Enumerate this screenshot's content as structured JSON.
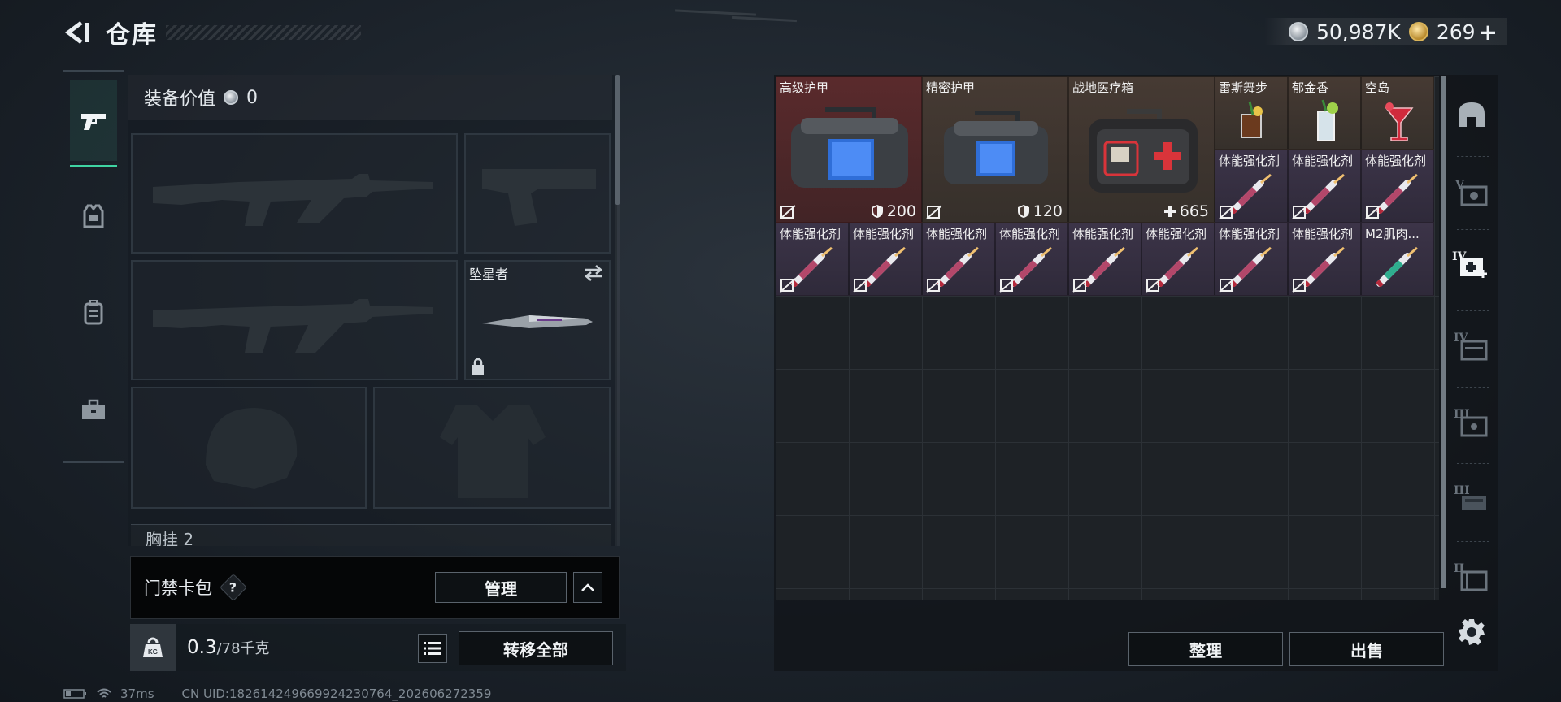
{
  "header": {
    "title": "仓库"
  },
  "currency": {
    "silver": "50,987K",
    "gold": "269",
    "plus": "+"
  },
  "side_tabs": [
    {
      "name": "tab-weapons",
      "icon": "pistol-icon",
      "active": true
    },
    {
      "name": "tab-armor",
      "icon": "armor-vest-icon",
      "active": false
    },
    {
      "name": "tab-backpack",
      "icon": "backpack-icon",
      "active": false
    },
    {
      "name": "tab-toolbox",
      "icon": "toolbox-icon",
      "active": false
    }
  ],
  "equipment": {
    "value_label": "装备价值",
    "value": "0",
    "melee_label": "坠星者",
    "chest_label": "胸挂 2"
  },
  "keycard": {
    "label": "门禁卡包",
    "help": "?",
    "manage": "管理"
  },
  "weight": {
    "current": "0.3",
    "max": "/78千克",
    "transfer_all": "转移全部"
  },
  "status": {
    "ping": "37ms",
    "uid": "CN UID:18261424966992423076​4_202606272359"
  },
  "inventory": {
    "items": [
      {
        "name": "高级护甲",
        "stat": "200",
        "stat_icon": "shield-icon"
      },
      {
        "name": "精密护甲",
        "stat": "120",
        "stat_icon": "shield-icon"
      },
      {
        "name": "战地医疗箱",
        "stat": "665",
        "stat_icon": "plus-icon"
      },
      {
        "name": "雷斯舞步"
      },
      {
        "name": "郁金香"
      },
      {
        "name": "空岛"
      },
      {
        "name": "体能强化剂"
      },
      {
        "name": "M2肌肉..."
      }
    ],
    "sort_label": "整理",
    "sell_label": "出售"
  },
  "right_nav": [
    {
      "name": "helmet-icon"
    },
    {
      "name": "vault-v-icon"
    },
    {
      "name": "vault-iv-medkit-icon"
    },
    {
      "name": "vault-iv-icon"
    },
    {
      "name": "vault-iii-icon"
    },
    {
      "name": "vault-iii-b-icon"
    },
    {
      "name": "vault-ii-icon"
    },
    {
      "name": "settings-gear-icon"
    }
  ],
  "colors": {
    "accent": "#3fd3a2",
    "rarity_red": "#5a2a2c",
    "rarity_brown": "#463a33",
    "rarity_purple": "#3c3448"
  }
}
